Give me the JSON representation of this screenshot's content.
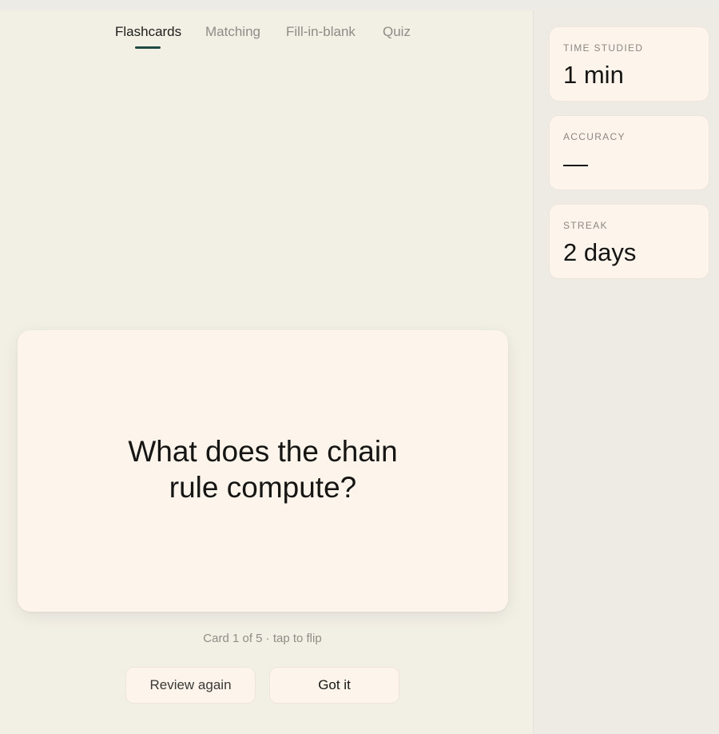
{
  "tabs": [
    {
      "label": "Flashcards",
      "active": true
    },
    {
      "label": "Matching",
      "active": false
    },
    {
      "label": "Fill-in-blank",
      "active": false
    },
    {
      "label": "Quiz",
      "active": false
    }
  ],
  "flashcard": {
    "question": "What does the chain rule compute?",
    "hint": "Card 1 of 5 · tap to flip"
  },
  "actions": {
    "review_label": "Review again",
    "got_label": "Got it"
  },
  "stats": [
    {
      "label": "TIME STUDIED",
      "value": "1 min"
    },
    {
      "label": "ACCURACY",
      "value": "—"
    },
    {
      "label": "STREAK",
      "value": "2 days"
    }
  ],
  "colors": {
    "accent": "#1f4a44",
    "card_background": "#fdf4ec",
    "page_background": "#f2efe5"
  }
}
